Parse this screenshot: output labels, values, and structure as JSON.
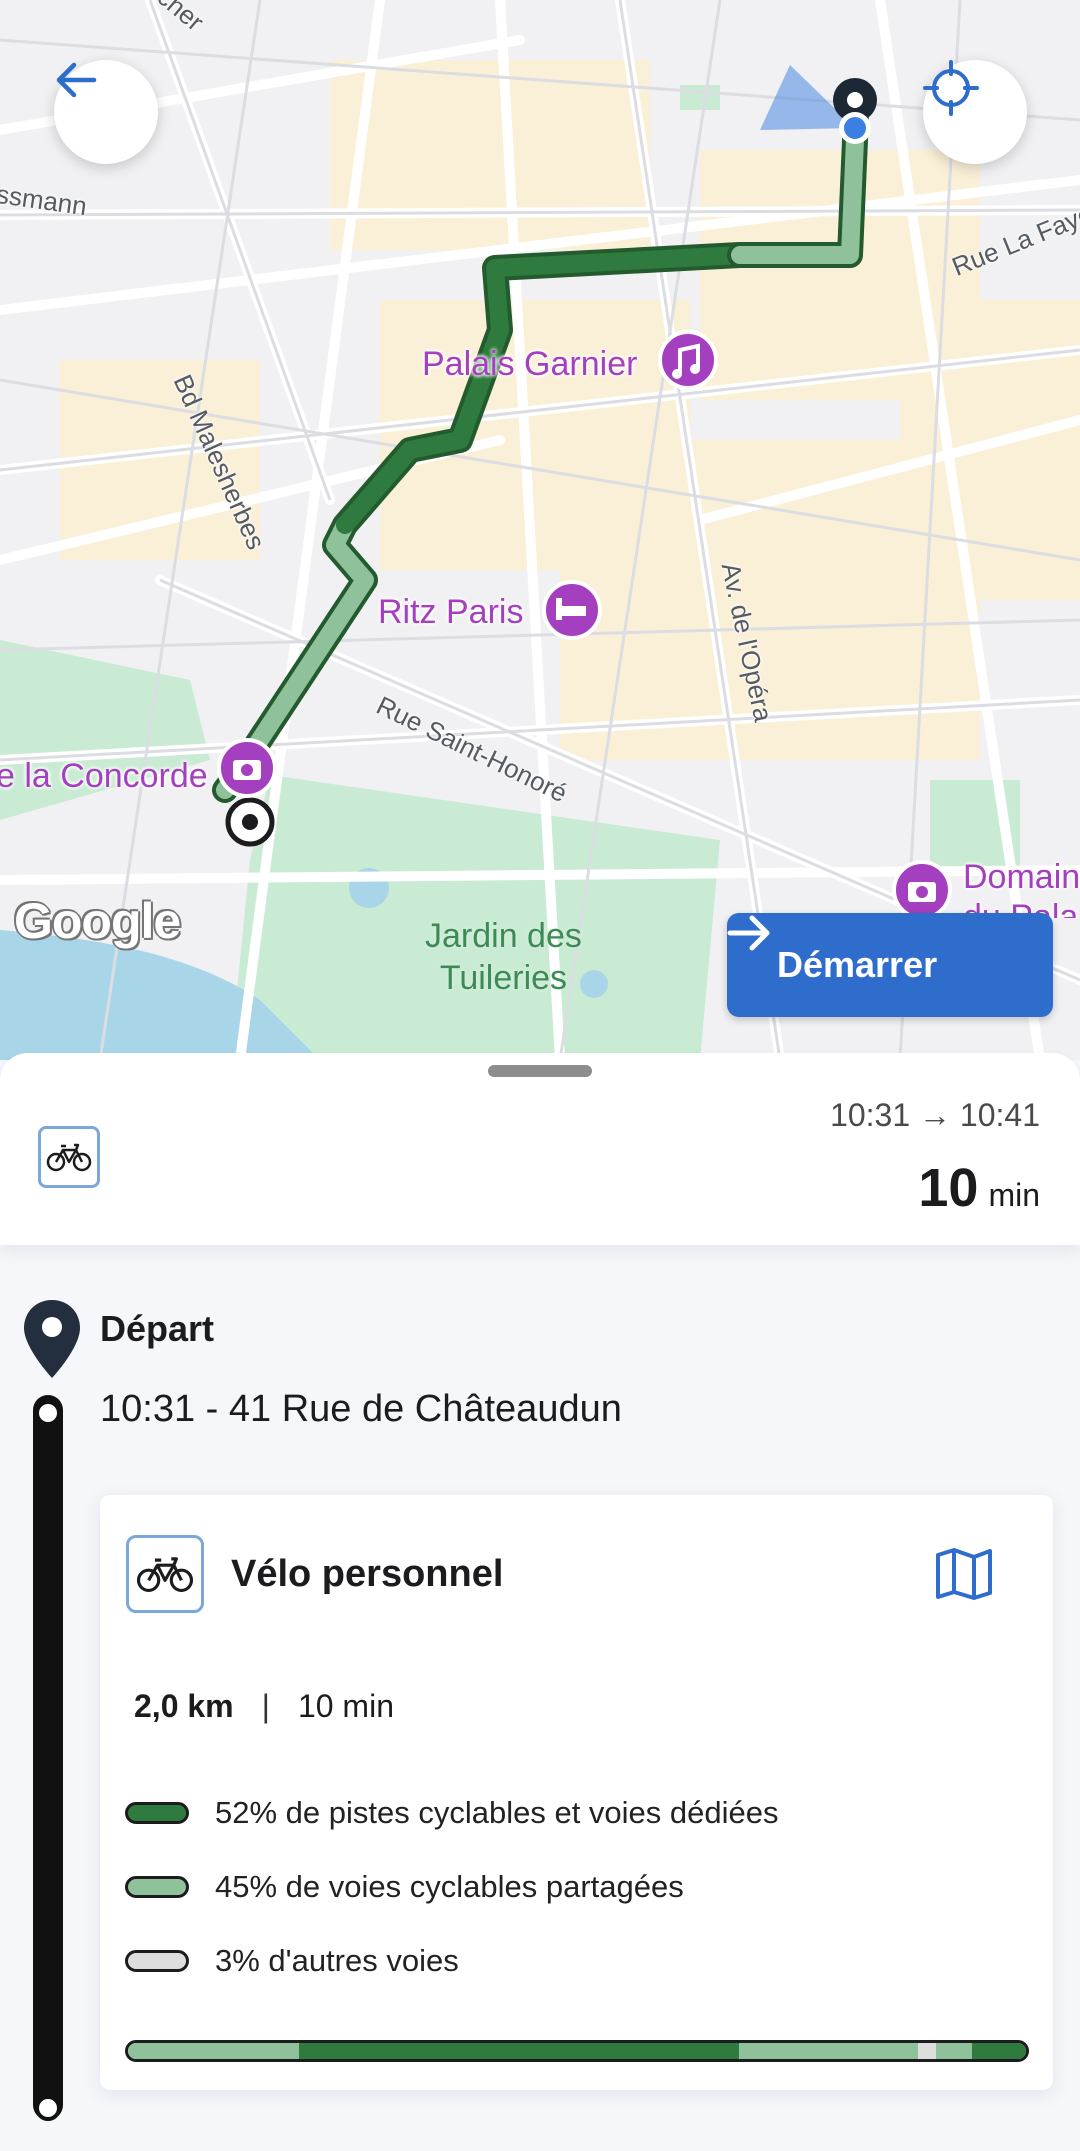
{
  "map": {
    "poi": {
      "palais_garnier": "Palais Garnier",
      "ritz_paris": "Ritz Paris",
      "concorde": "e la Concorde",
      "domaine": "Domain",
      "domaine_line2": "du Pala"
    },
    "streets": {
      "haussmann": "ssmann",
      "malesherbes": "Bd Malesherbes",
      "la_fayette": "Rue La Faye",
      "saint_honore": "Rue Saint-Honoré",
      "opera": "Av. de l'Opéra",
      "top_left": "cher"
    },
    "park": {
      "tuileries_line1": "Jardin des",
      "tuileries_line2": "Tuileries"
    },
    "attribution": "Google"
  },
  "actions": {
    "start_label": "Démarrer",
    "back_icon": "arrow-left-icon",
    "locate_icon": "crosshair-icon"
  },
  "summary": {
    "mode_icon": "bicycle-icon",
    "times": "10:31 → 10:41",
    "duration_value": "10",
    "duration_unit": "min"
  },
  "itinerary": {
    "depart_title": "Départ",
    "depart_address": "10:31 - 41 Rue de Châteaudun",
    "leg": {
      "title": "Vélo personnel",
      "map_icon": "map-icon",
      "distance": "2,0 km",
      "separator": "|",
      "duration": "10 min",
      "breakdown": [
        {
          "label": "52% de pistes cyclables et voies dédiées",
          "color": "#2f7a3e",
          "percent": 52
        },
        {
          "label": "45% de voies cyclables partagées",
          "color": "#8fc29a",
          "percent": 45
        },
        {
          "label": "3% d'autres voies",
          "color": "#dedede",
          "percent": 3
        }
      ],
      "route_segments": [
        {
          "color": "#8fc29a",
          "percent": 19
        },
        {
          "color": "#2f7a3e",
          "percent": 49
        },
        {
          "color": "#8fc29a",
          "percent": 20
        },
        {
          "color": "#dedede",
          "percent": 2
        },
        {
          "color": "#8fc29a",
          "percent": 4
        },
        {
          "color": "#2f7a3e",
          "percent": 6
        }
      ]
    }
  }
}
